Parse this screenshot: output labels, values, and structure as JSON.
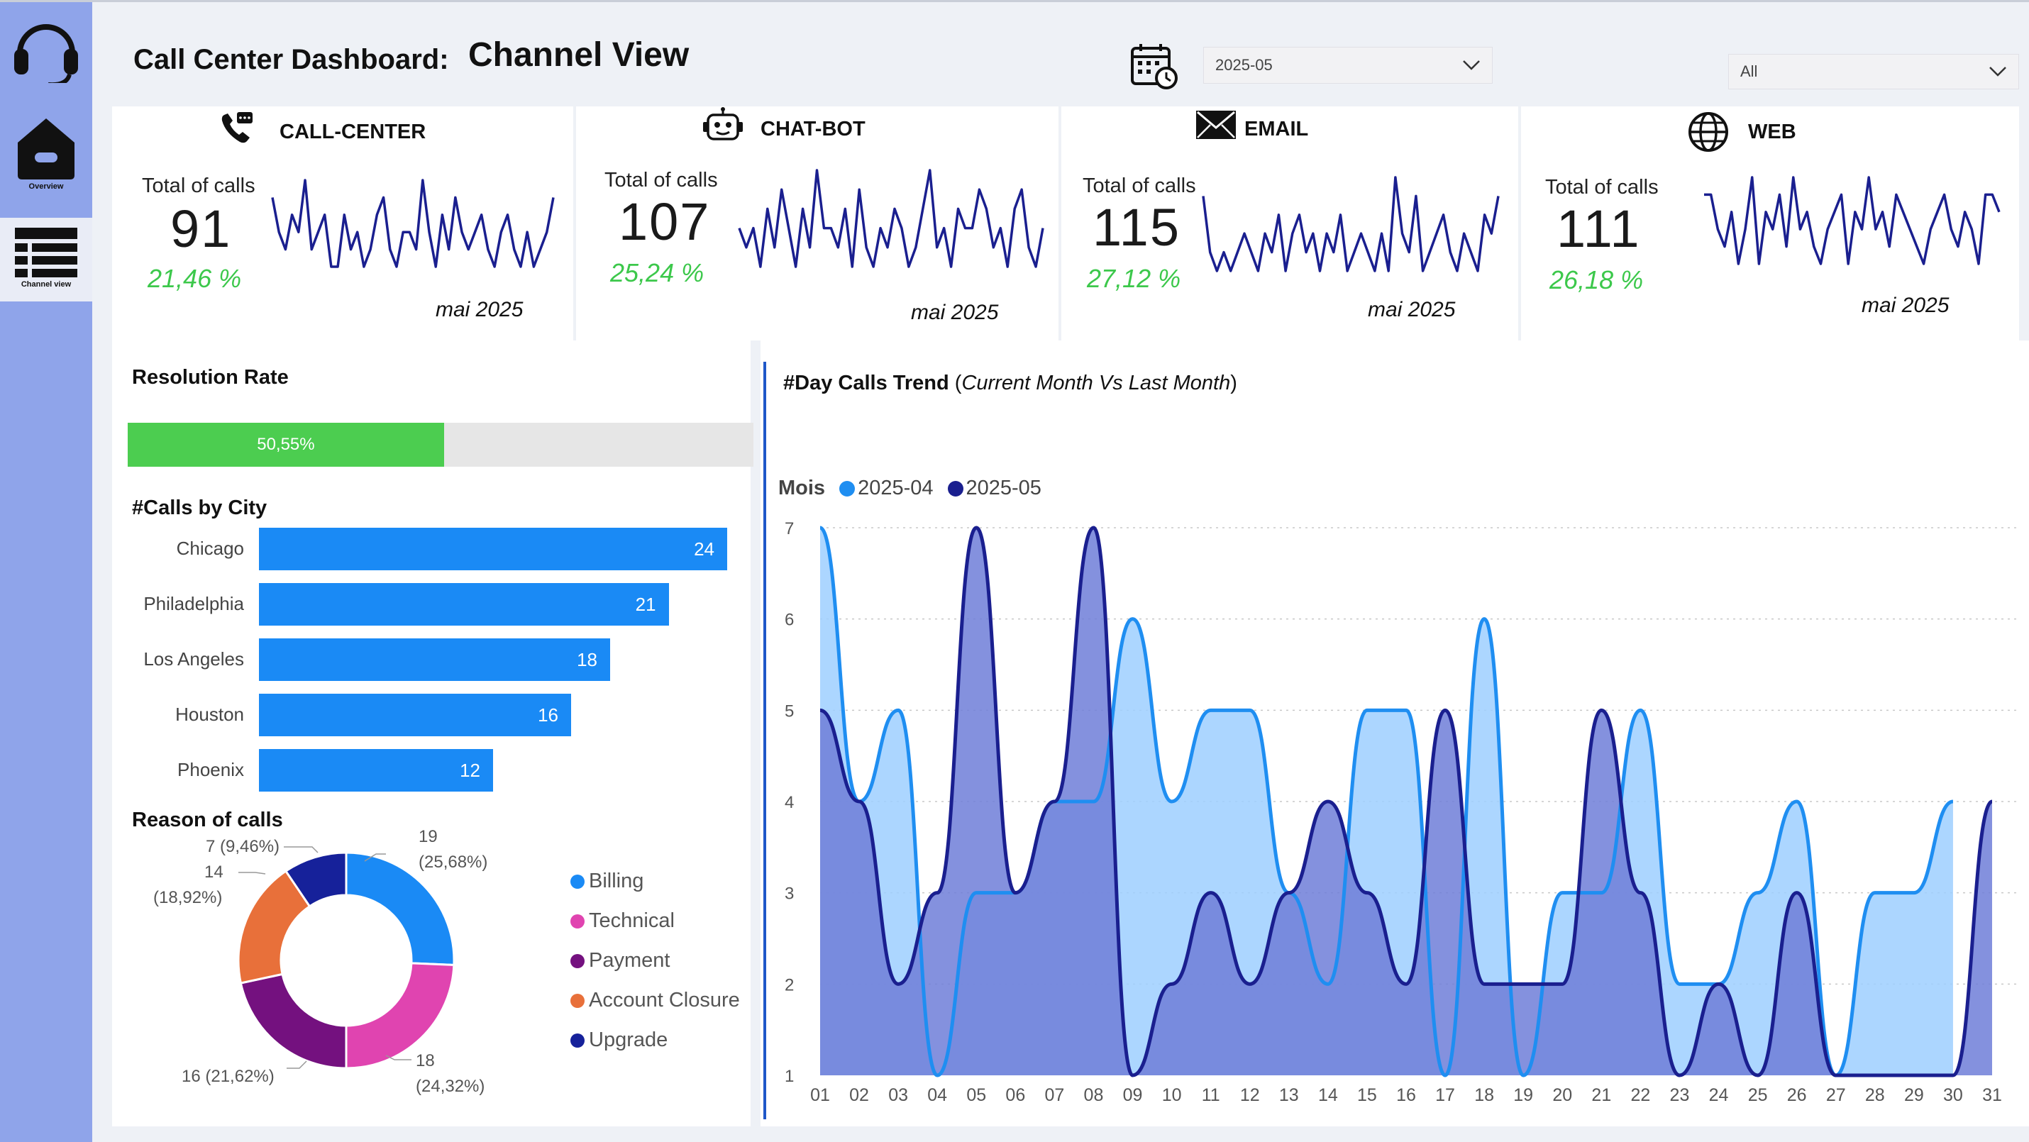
{
  "nav": {
    "overview_label": "Overview",
    "channel_view_label": "Channel view"
  },
  "header": {
    "title": "Call Center Dashboard:",
    "subtitle": "Channel View",
    "month_select": "2025-05",
    "filter_select": "All"
  },
  "cards": [
    {
      "title": "CALL-CENTER",
      "total_label": "Total of calls",
      "total": "91",
      "pct": "21,46 %",
      "month": "mai 2025",
      "spark": [
        5,
        3,
        2,
        4,
        3,
        6,
        2,
        3,
        4,
        1,
        1,
        4,
        2,
        3,
        1,
        2,
        4,
        5,
        2,
        1,
        3,
        3,
        2,
        6,
        3,
        1,
        4,
        2,
        5,
        3,
        2,
        3,
        4,
        2,
        1,
        3,
        4,
        2,
        1,
        3,
        1,
        2,
        3,
        5
      ]
    },
    {
      "title": "CHAT-BOT",
      "total_label": "Total of calls",
      "total": "107",
      "pct": "25,24 %",
      "month": "mai 2025",
      "spark": [
        3,
        2,
        3,
        1,
        4,
        2,
        5,
        3,
        1,
        4,
        2,
        6,
        3,
        3,
        2,
        4,
        1,
        5,
        2,
        1,
        3,
        2,
        4,
        3,
        1,
        2,
        4,
        6,
        2,
        3,
        1,
        4,
        3,
        3,
        5,
        4,
        2,
        3,
        1,
        4,
        5,
        2,
        1,
        3
      ]
    },
    {
      "title": "EMAIL",
      "total_label": "Total of calls",
      "total": "115",
      "pct": "27,12 %",
      "month": "mai 2025",
      "spark": [
        5,
        2,
        1,
        2,
        1,
        2,
        3,
        2,
        1,
        3,
        2,
        4,
        1,
        3,
        4,
        2,
        3,
        1,
        3,
        2,
        4,
        1,
        2,
        3,
        2,
        1,
        3,
        1,
        6,
        3,
        2,
        5,
        1,
        2,
        3,
        4,
        2,
        1,
        3,
        2,
        1,
        4,
        3,
        5
      ]
    },
    {
      "title": "WEB",
      "total_label": "Total of calls",
      "total": "111",
      "pct": "26,18 %",
      "month": "mai 2025",
      "spark": [
        5,
        5,
        3,
        2,
        4,
        1,
        3,
        6,
        1,
        4,
        3,
        5,
        2,
        6,
        3,
        4,
        2,
        1,
        3,
        4,
        5,
        1,
        4,
        3,
        6,
        3,
        4,
        2,
        5,
        4,
        3,
        2,
        1,
        3,
        4,
        5,
        3,
        2,
        4,
        3,
        1,
        5,
        5,
        4
      ]
    }
  ],
  "resolution": {
    "title": "Resolution Rate",
    "label": "50,55%",
    "value": 0.5055
  },
  "cities": {
    "title": "#Calls by City",
    "items": [
      {
        "name": "Chicago",
        "value": 24
      },
      {
        "name": "Philadelphia",
        "value": 21
      },
      {
        "name": "Los Angeles",
        "value": 18
      },
      {
        "name": "Houston",
        "value": 16
      },
      {
        "name": "Phoenix",
        "value": 12
      }
    ]
  },
  "reasons": {
    "title": "Reason of calls",
    "items": [
      {
        "name": "Billing",
        "value": 19,
        "label1": "19",
        "label2": "(25,68%)",
        "color": "#1a8af5"
      },
      {
        "name": "Technical",
        "value": 18,
        "label1": "18",
        "label2": "(24,32%)",
        "color": "#e044b0"
      },
      {
        "name": "Payment",
        "value": 16,
        "label1": "16 (21,62%)",
        "label2": "",
        "color": "#74117f"
      },
      {
        "name": "Account Closure",
        "value": 14,
        "label1": "14",
        "label2": "(18,92%)",
        "color": "#e8703a"
      },
      {
        "name": "Upgrade",
        "value": 7,
        "label1": "7 (9,46%)",
        "label2": "",
        "color": "#16219a"
      }
    ]
  },
  "trend": {
    "title_bold": "#Day Calls Trend",
    "title_italic": "Current Month Vs Last Month",
    "legend_title": "Mois"
  },
  "chart_data": {
    "type": "area",
    "x": [
      "01",
      "02",
      "03",
      "04",
      "05",
      "06",
      "07",
      "08",
      "09",
      "10",
      "11",
      "12",
      "13",
      "14",
      "15",
      "16",
      "17",
      "18",
      "19",
      "20",
      "21",
      "22",
      "23",
      "24",
      "25",
      "26",
      "27",
      "28",
      "29",
      "30",
      "31"
    ],
    "ylim": [
      1,
      7
    ],
    "yticks": [
      1,
      2,
      3,
      4,
      5,
      6,
      7
    ],
    "series": [
      {
        "name": "2025-04",
        "color": "#1f8ef1",
        "fill": "#9ecfff",
        "values": [
          7,
          4,
          5,
          1,
          3,
          3,
          4,
          4,
          6,
          4,
          5,
          5,
          3,
          2,
          5,
          5,
          1,
          6,
          1,
          3,
          3,
          5,
          2,
          2,
          3,
          4,
          1,
          3,
          3,
          4,
          null
        ]
      },
      {
        "name": "2025-05",
        "color": "#1a1f8f",
        "fill": "#6f7ed8",
        "values": [
          5,
          4,
          2,
          3,
          7,
          3,
          4,
          7,
          1,
          2,
          3,
          2,
          3,
          4,
          3,
          2,
          5,
          2,
          2,
          2,
          5,
          3,
          1,
          2,
          1,
          3,
          1,
          1,
          1,
          1,
          4
        ]
      }
    ]
  }
}
